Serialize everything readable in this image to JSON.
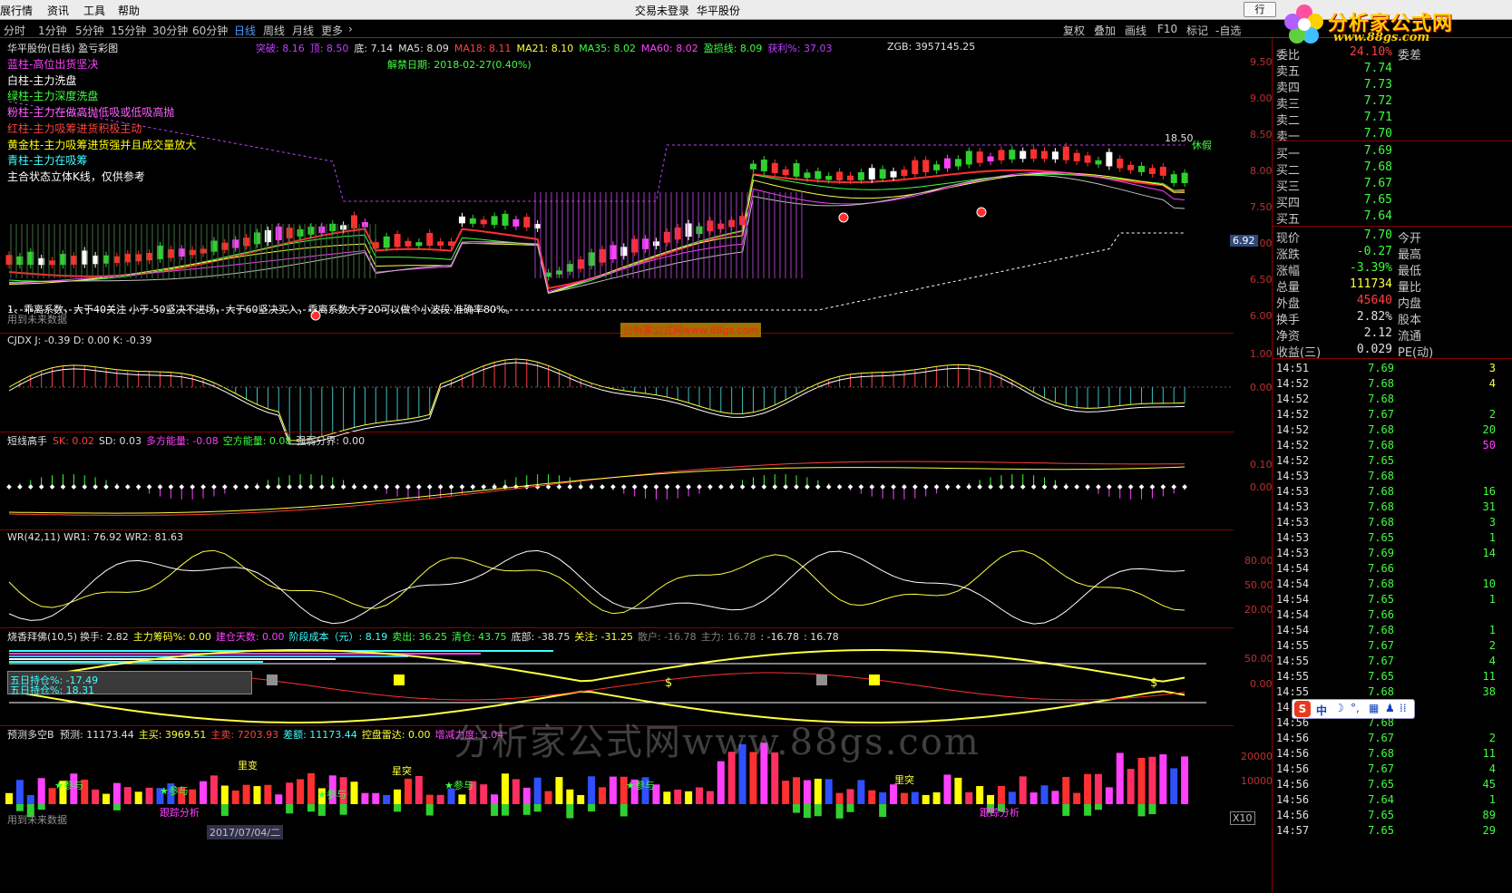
{
  "menubar": {
    "items": [
      "展行情",
      "资讯",
      "工具",
      "帮助"
    ],
    "login_status": "交易未登录",
    "stock_name": "华平股份",
    "hq_button": "行"
  },
  "periodbar": {
    "periods": [
      "分时",
      "1分钟",
      "5分钟",
      "15分钟",
      "30分钟",
      "60分钟",
      "日线",
      "周线",
      "月线",
      "更多"
    ],
    "active": "日线",
    "tools": [
      "复权",
      "叠加",
      "画线",
      "F10",
      "标记",
      "-自选"
    ]
  },
  "logo": {
    "title": "分析家公式网",
    "url": "www.88gs.com"
  },
  "main": {
    "title": "华平股份(日线) 盈亏彩图",
    "indicators": [
      {
        "text": "突破: 8.16",
        "color": "#c040ff"
      },
      {
        "text": "顶: 8.50",
        "color": "#c040ff"
      },
      {
        "text": "底: 7.14",
        "color": "#e0e0e0"
      },
      {
        "text": "MA5: 8.09",
        "color": "#e0e0e0"
      },
      {
        "text": "MA18: 8.11",
        "color": "#ff4040"
      },
      {
        "text": "MA21: 8.10",
        "color": "#ffff40"
      },
      {
        "text": "MA35: 8.02",
        "color": "#40ff40"
      },
      {
        "text": "MA60: 8.02",
        "color": "#ff40ff"
      },
      {
        "text": "盈损线: 8.09",
        "color": "#40ff40"
      },
      {
        "text": "获利%: 37.03",
        "color": "#c040ff"
      }
    ],
    "zgb": "ZGB: 3957145.25",
    "unlock_date": "解禁日期: 2018-02-27(0.40%)",
    "legend": [
      {
        "text": "蓝柱-高位出货坚决",
        "color": "#ff40ff"
      },
      {
        "text": "白柱-主力洗盘",
        "color": "#ffffff"
      },
      {
        "text": "绿柱-主力深度洗盘",
        "color": "#40ff40"
      },
      {
        "text": "粉柱-主力在做高抛低吸或低吸高抛",
        "color": "#ff60ff"
      },
      {
        "text": "红柱-主力吸筹进货积极主动",
        "color": "#ff4040"
      },
      {
        "text": "黄金柱-主力吸筹进货强并且成交量放大",
        "color": "#ffff00"
      },
      {
        "text": "青柱-主力在吸筹",
        "color": "#40ffff"
      },
      {
        "text": "主合状态立体K线，仅供参考",
        "color": "#ffffff"
      }
    ],
    "note": "1、乖离系数，大于40关注 小于-50坚决不进场，大于60坚决买入，乖离系数大于20可以做个小波段 准确率80%。",
    "use_future": "用到未来数据",
    "watermark_box": "分析家公式网www.88gs.com",
    "y_axis": [
      "9.50",
      "9.00",
      "8.50",
      "8.00",
      "7.50",
      "7.00",
      "6.50",
      "6.00"
    ],
    "price_tag": "6.92",
    "signals": [
      "休假",
      "18.50"
    ]
  },
  "cjdx": {
    "title": "CJDX J: -0.39  D: 0.00  K: -0.39",
    "y_axis": [
      "1.00",
      "0.00"
    ]
  },
  "dxgs": {
    "title": "短线高手",
    "indicators": [
      {
        "text": "SK: 0.02",
        "color": "#ff4040"
      },
      {
        "text": "SD: 0.03",
        "color": "#e0e0e0"
      },
      {
        "text": "多方能量: -0.08",
        "color": "#ff40ff"
      },
      {
        "text": "空方能量: 0.08",
        "color": "#40ff40"
      },
      {
        "text": "强弱分界: 0.00",
        "color": "#e0e0e0"
      }
    ],
    "y_axis": [
      "0.10",
      "0.00"
    ]
  },
  "wr": {
    "title": "WR(42,11)  WR1: 76.92  WR2: 81.63",
    "y_axis": [
      "80.00",
      "50.00",
      "20.00"
    ]
  },
  "sxbf": {
    "title": "烧香拜佛(10,5)",
    "indicators": [
      {
        "text": "换手: 2.82",
        "color": "#e0e0e0"
      },
      {
        "text": "主力筹码%: 0.00",
        "color": "#ffff40"
      },
      {
        "text": "建仓天数: 0.00",
        "color": "#ff40ff"
      },
      {
        "text": "阶段成本（元）: 8.19",
        "color": "#40ffff"
      },
      {
        "text": "卖出: 36.25",
        "color": "#40ff40"
      },
      {
        "text": "清仓: 43.75",
        "color": "#40ff40"
      },
      {
        "text": "底部: -38.75",
        "color": "#e0e0e0"
      },
      {
        "text": "关注: -31.25",
        "color": "#ffff40"
      },
      {
        "text": "散户: -16.78",
        "color": "#808080"
      },
      {
        "text": "主力: 16.78",
        "color": "#808080"
      },
      {
        "text": ": -16.78",
        "color": "#e0e0e0"
      },
      {
        "text": ": 16.78",
        "color": "#e0e0e0"
      }
    ],
    "box_line1": "五日持仓%: -17.49",
    "box_line2": "五日持仓%: 18.31",
    "dollar": "$",
    "y_axis": [
      "50.00",
      "0.00"
    ]
  },
  "ycdk": {
    "title": "预测多空B",
    "indicators": [
      {
        "text": "预测: 11173.44",
        "color": "#e0e0e0"
      },
      {
        "text": "主买: 3969.51",
        "color": "#ffff40"
      },
      {
        "text": "主卖: 7203.93",
        "color": "#ff4040"
      },
      {
        "text": "差额: 11173.44",
        "color": "#40ffff"
      },
      {
        "text": "控盘雷达: 0.00",
        "color": "#ffff40"
      },
      {
        "text": "增减力度: 2.04",
        "color": "#ff40ff"
      }
    ],
    "markers": [
      "★参与",
      "★参与",
      "★参与",
      "★参与",
      "★参与",
      "里变",
      "星突",
      "里突",
      "跟踪分析",
      "跟踪分析"
    ],
    "y_axis": [
      "20000",
      "10000"
    ],
    "use_future": "用到未来数据",
    "x10": "X10",
    "bottom_date": "2017/07/04/二"
  },
  "watermark": "分析家公式网www.88gs.com",
  "ime": "中",
  "panel": {
    "ratio_label": "委比",
    "ratio_value": "24.10%",
    "diff_label": "委差",
    "sell": [
      {
        "label": "卖五",
        "price": "7.74"
      },
      {
        "label": "卖四",
        "price": "7.73"
      },
      {
        "label": "卖三",
        "price": "7.72"
      },
      {
        "label": "卖二",
        "price": "7.71"
      },
      {
        "label": "卖一",
        "price": "7.70"
      }
    ],
    "buy": [
      {
        "label": "买一",
        "price": "7.69"
      },
      {
        "label": "买二",
        "price": "7.68"
      },
      {
        "label": "买三",
        "price": "7.67"
      },
      {
        "label": "买四",
        "price": "7.65"
      },
      {
        "label": "买五",
        "price": "7.64"
      }
    ],
    "stats": [
      {
        "k": "现价",
        "v": "7.70",
        "n": "今开",
        "color": "#40ff40"
      },
      {
        "k": "涨跌",
        "v": "-0.27",
        "n": "最高",
        "color": "#40ff40"
      },
      {
        "k": "涨幅",
        "v": "-3.39%",
        "n": "最低",
        "color": "#40ff40"
      },
      {
        "k": "总量",
        "v": "111734",
        "n": "量比",
        "color": "#ffff40"
      },
      {
        "k": "外盘",
        "v": "45640",
        "n": "内盘",
        "color": "#ff4040"
      },
      {
        "k": "换手",
        "v": "2.82%",
        "n": "股本",
        "color": "#e0e0e0"
      },
      {
        "k": "净资",
        "v": "2.12",
        "n": "流通",
        "color": "#e0e0e0"
      },
      {
        "k": "收益(三)",
        "v": "0.029",
        "n": "PE(动)",
        "color": "#e0e0e0"
      }
    ],
    "ticks": [
      {
        "t": "14:51",
        "p": "7.69",
        "v": "3",
        "vc": "#ffff40"
      },
      {
        "t": "14:52",
        "p": "7.68",
        "v": "4",
        "vc": "#ffff40"
      },
      {
        "t": "14:52",
        "p": "7.68",
        "v": "",
        "vc": "#ffff40"
      },
      {
        "t": "14:52",
        "p": "7.67",
        "v": "2",
        "vc": "#40ff40"
      },
      {
        "t": "14:52",
        "p": "7.68",
        "v": "20",
        "vc": "#40ff40"
      },
      {
        "t": "14:52",
        "p": "7.68",
        "v": "50",
        "vc": "#ff40ff"
      },
      {
        "t": "14:52",
        "p": "7.65",
        "v": "",
        "vc": "#40ff40"
      },
      {
        "t": "14:53",
        "p": "7.68",
        "v": "",
        "vc": "#40ff40"
      },
      {
        "t": "14:53",
        "p": "7.68",
        "v": "16",
        "vc": "#40ff40"
      },
      {
        "t": "14:53",
        "p": "7.68",
        "v": "31",
        "vc": "#40ff40"
      },
      {
        "t": "14:53",
        "p": "7.68",
        "v": "3",
        "vc": "#40ff40"
      },
      {
        "t": "14:53",
        "p": "7.65",
        "v": "1",
        "vc": "#40ff40"
      },
      {
        "t": "14:53",
        "p": "7.69",
        "v": "14",
        "vc": "#40ff40"
      },
      {
        "t": "14:54",
        "p": "7.66",
        "v": "",
        "vc": "#40ff40"
      },
      {
        "t": "14:54",
        "p": "7.68",
        "v": "10",
        "vc": "#40ff40"
      },
      {
        "t": "14:54",
        "p": "7.65",
        "v": "1",
        "vc": "#40ff40"
      },
      {
        "t": "14:54",
        "p": "7.66",
        "v": "",
        "vc": "#40ff40"
      },
      {
        "t": "14:54",
        "p": "7.68",
        "v": "1",
        "vc": "#40ff40"
      },
      {
        "t": "14:55",
        "p": "7.67",
        "v": "2",
        "vc": "#40ff40"
      },
      {
        "t": "14:55",
        "p": "7.67",
        "v": "4",
        "vc": "#40ff40"
      },
      {
        "t": "14:55",
        "p": "7.65",
        "v": "11",
        "vc": "#40ff40"
      },
      {
        "t": "14:55",
        "p": "7.68",
        "v": "38",
        "vc": "#40ff40"
      },
      {
        "t": "14:55",
        "p": "",
        "v": "",
        "vc": "#40ff40"
      },
      {
        "t": "14:56",
        "p": "7.68",
        "v": "",
        "vc": "#40ff40"
      },
      {
        "t": "14:56",
        "p": "7.67",
        "v": "2",
        "vc": "#40ff40"
      },
      {
        "t": "14:56",
        "p": "7.68",
        "v": "11",
        "vc": "#40ff40"
      },
      {
        "t": "14:56",
        "p": "7.67",
        "v": "4",
        "vc": "#40ff40"
      },
      {
        "t": "14:56",
        "p": "7.65",
        "v": "45",
        "vc": "#40ff40"
      },
      {
        "t": "14:56",
        "p": "7.64",
        "v": "1",
        "vc": "#40ff40"
      },
      {
        "t": "14:56",
        "p": "7.65",
        "v": "89",
        "vc": "#40ff40"
      },
      {
        "t": "14:57",
        "p": "7.65",
        "v": "29",
        "vc": "#40ff40"
      }
    ]
  },
  "colors": {
    "up": "#ff3030",
    "down": "#30d030",
    "separator": "#8a0000",
    "active_period": "#4a9cff"
  }
}
